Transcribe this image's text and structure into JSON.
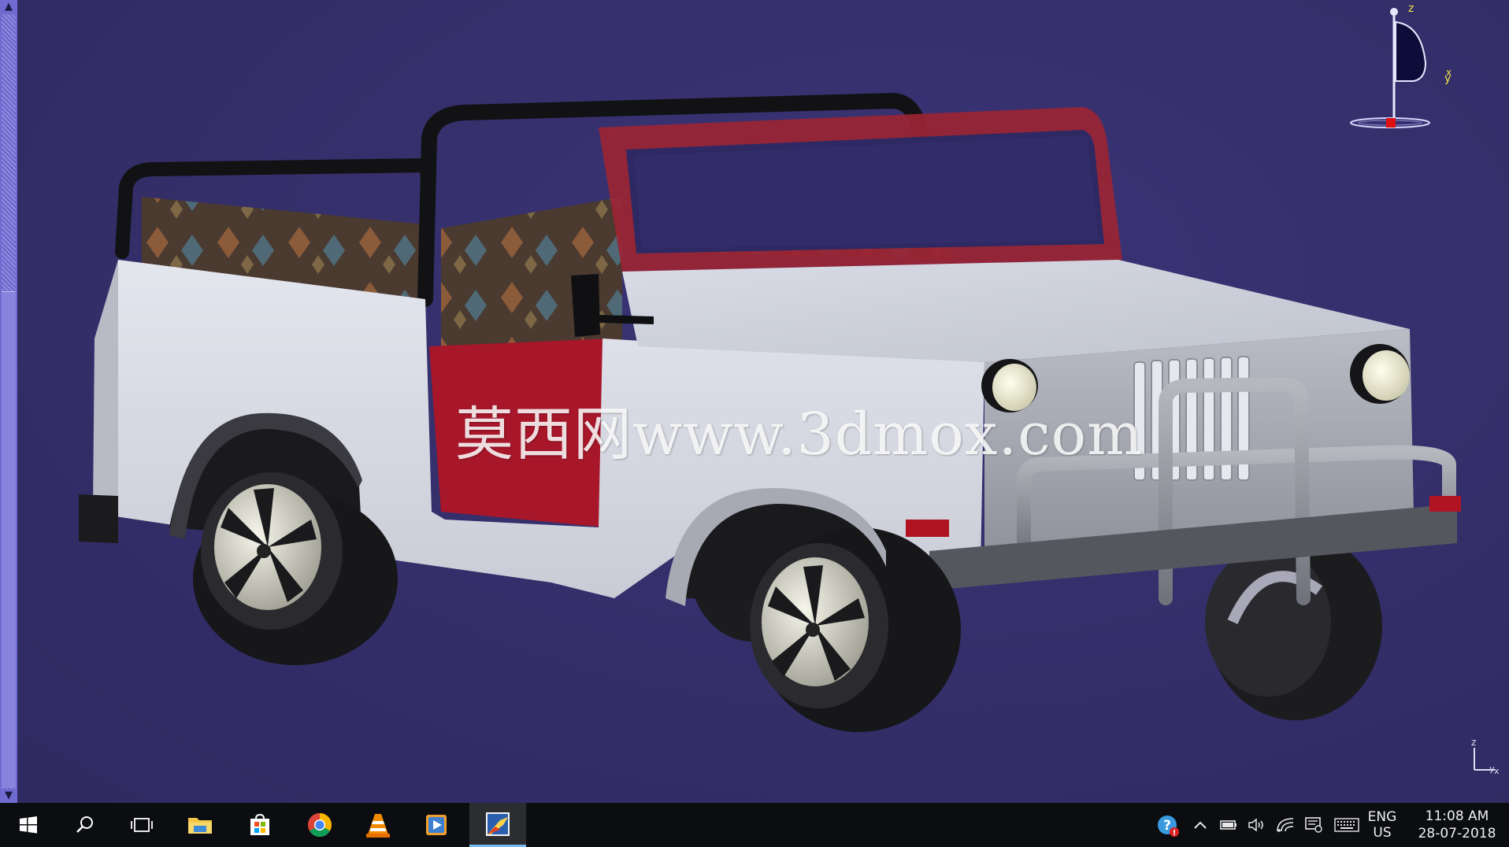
{
  "watermark": "莫西网www.3dmox.com",
  "compass": {
    "z_label": "z",
    "y_label": "y",
    "x_label": "x"
  },
  "mini_axis": {
    "z_label": "z",
    "x_label": "x",
    "y_label": "y"
  },
  "taskbar": {
    "apps": [
      {
        "name": "start-button",
        "icon": "windows-logo-icon"
      },
      {
        "name": "search-button",
        "icon": "search-icon"
      },
      {
        "name": "task-view-button",
        "icon": "task-view-icon"
      },
      {
        "name": "file-explorer-button",
        "icon": "folder-icon"
      },
      {
        "name": "store-button",
        "icon": "store-icon"
      },
      {
        "name": "chrome-button",
        "icon": "chrome-icon"
      },
      {
        "name": "vlc-button",
        "icon": "vlc-cone-icon"
      },
      {
        "name": "media-player-button",
        "icon": "media-play-icon"
      },
      {
        "name": "catia-button",
        "icon": "catia-icon"
      }
    ],
    "tray": {
      "lang_primary": "ENG",
      "lang_secondary": "US",
      "time": "11:08 AM",
      "date": "28-07-2018"
    }
  },
  "colors": {
    "viewport_bg": "#352f6c",
    "taskbar_bg": "#0b0d10",
    "accent": "#76b9ed"
  }
}
